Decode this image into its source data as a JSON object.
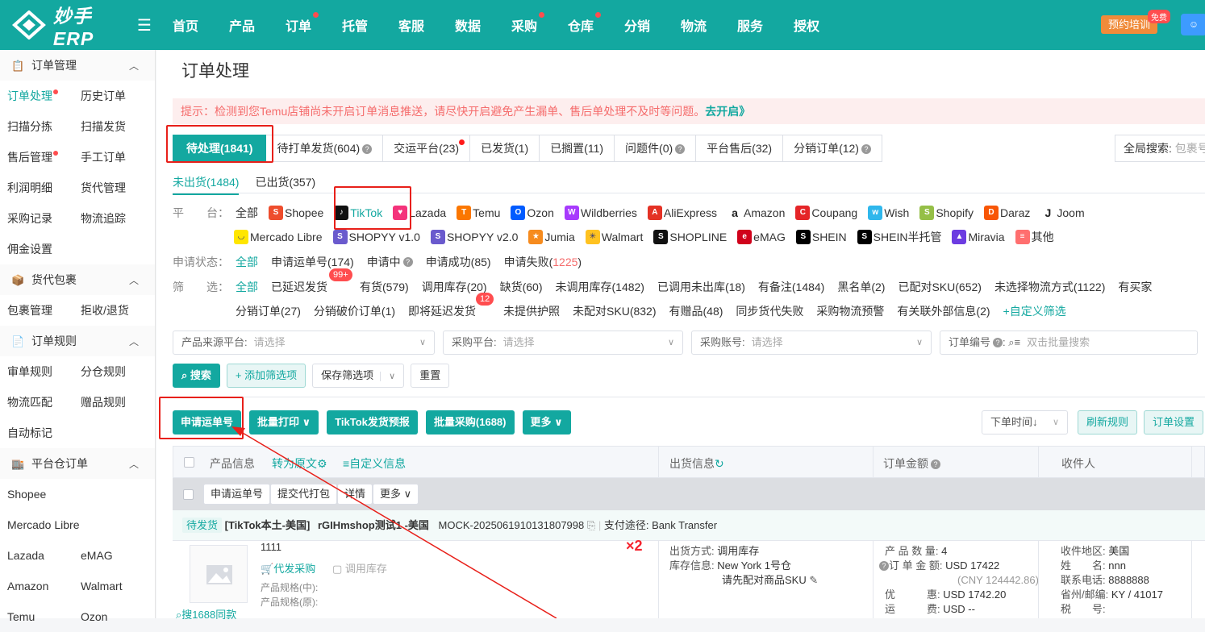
{
  "app": {
    "name": "妙手ERP",
    "train_label": "预约培训",
    "free_badge": "免费"
  },
  "nav": [
    "首页",
    "产品",
    "订单",
    "托管",
    "客服",
    "数据",
    "采购",
    "仓库",
    "分销",
    "物流",
    "服务",
    "授权"
  ],
  "sidebar": {
    "sections": [
      {
        "title": "订单管理",
        "items": [
          "订单处理",
          "历史订单",
          "扫描分拣",
          "扫描发货",
          "售后管理",
          "手工订单",
          "利润明细",
          "货代管理",
          "采购记录",
          "物流追踪",
          "佣金设置"
        ]
      },
      {
        "title": "货代包裹",
        "items": [
          "包裹管理",
          "拒收/退货"
        ]
      },
      {
        "title": "订单规则",
        "items": [
          "审单规则",
          "分仓规则",
          "物流匹配",
          "赠品规则",
          "自动标记"
        ]
      },
      {
        "title": "平台仓订单",
        "items": [
          "Shopee",
          "",
          "Mercado Libre",
          "",
          "Lazada",
          "eMAG",
          "Amazon",
          "Walmart",
          "Temu",
          "Ozon"
        ]
      }
    ]
  },
  "page": {
    "title": "订单处理",
    "notice": "提示：检测到您Temu店铺尚未开启订单消息推送，请尽快开启避免产生漏单、售后单处理不及时等问题。",
    "notice_link": "去开启》",
    "tabs": [
      "待处理(1841)",
      "待打单发货(604)",
      "交运平台(23)",
      "已发货(1)",
      "已搁置(11)",
      "问题件(0)",
      "平台售后(32)",
      "分销订单(12)"
    ],
    "global_search_label": "全局搜索:",
    "global_search_placeholder": "包裹号",
    "subtabs": [
      "未出货(1484)",
      "已出货(357)"
    ],
    "platform_label": "平　　台：",
    "platform_all": "全部",
    "platforms_row1": [
      "Shopee",
      "TikTok",
      "Lazada",
      "Temu",
      "Ozon",
      "Wildberries",
      "AliExpress",
      "Amazon",
      "Coupang",
      "Wish",
      "Shopify",
      "Daraz",
      "Joom"
    ],
    "platforms_row2": [
      "Mercado Libre",
      "SHOPYY v1.0",
      "SHOPYY v2.0",
      "Jumia",
      "Walmart",
      "SHOPLINE",
      "eMAG",
      "SHEIN",
      "SHEIN半托管",
      "Miravia",
      "其他"
    ],
    "apply_label": "申请状态：",
    "apply_status": [
      "全部",
      "申请运单号(174)",
      "申请中",
      "申请成功(85)",
      "申请失败("
    ],
    "apply_fail_count": "1225",
    "filter_label": "筛　　选：",
    "filters_row1": [
      "全部",
      "已延迟发货",
      "有货(579)",
      "调用库存(20)",
      "缺货(60)",
      "未调用库存(1482)",
      "已调用未出库(18)",
      "有备注(1484)",
      "黑名单(2)",
      "已配对SKU(652)",
      "未选择物流方式(1122)",
      "有买家"
    ],
    "delay_badge": "99+",
    "filters_row2": [
      "分销订单(27)",
      "分销破价订单(1)",
      "即将延迟发货",
      "未提供护照",
      "未配对SKU(832)",
      "有赠品(48)",
      "同步货代失败",
      "采购物流预警",
      "有关联外部信息(2)",
      "+自定义筛选"
    ],
    "soon_badge": "12",
    "selects": [
      {
        "label": "产品来源平台:",
        "placeholder": "请选择"
      },
      {
        "label": "采购平台:",
        "placeholder": "请选择"
      },
      {
        "label": "采购账号:",
        "placeholder": "请选择"
      },
      {
        "label": "订单编号",
        "placeholder": "双击批量搜索"
      }
    ],
    "buttons": {
      "search": "搜索",
      "add_filter": "+ 添加筛选项",
      "save_filter": "保存筛选项",
      "reset": "重置"
    },
    "actions": [
      "申请运单号",
      "批量打印",
      "TikTok发货预报",
      "批量采购(1688)",
      "更多"
    ],
    "sort": "下单时间↓",
    "refresh_rule": "刷新规则",
    "order_setting": "订单设置",
    "table_headers": {
      "product": "产品信息",
      "translate": "转为原文",
      "custom": "自定义信息",
      "shipping": "出货信息",
      "amount": "订单金额",
      "receiver": "收件人"
    },
    "bulk": [
      "申请运单号",
      "提交代打包",
      "详情",
      "更多"
    ],
    "order": {
      "status": "待发货",
      "shop": "[TikTok本土-美国]",
      "shop_name": "rGIHmshop测试1 -美国",
      "order_no": "MOCK-20250619101318079​98",
      "pay_label": "支付途径:",
      "pay": "Bank Transfer",
      "product_name": "1111",
      "qty_mark": "×2",
      "agent_buy": "代发采购",
      "use_stock": "调用库存",
      "search_1688": "搜1688同款",
      "spec_cn": "产品规格(中):",
      "spec_raw": "产品规格(原):",
      "ship_way_label": "出货方式:",
      "ship_way": "调用库存",
      "stock_info_label": "库存信息:",
      "stock_info": "New York 1号仓",
      "pair_hint": "请先配对商品SKU",
      "qty_label": "产 品 数 量:",
      "qty": "4",
      "amount_label": "订 单 金 额:",
      "amount": "USD 17422",
      "amount_cny": "(CNY 124442.86)",
      "discount_label": "优　　　惠:",
      "discount": "USD 1742.20",
      "freight_label": "运　　　费:",
      "freight": "USD --",
      "region_label": "收件地区:",
      "region": "美国",
      "name_label": "姓　　名:",
      "name": "nnn",
      "phone_label": "联系电话:",
      "phone": "8888888",
      "zip_label": "省州/邮编:",
      "zip": "KY / 41017",
      "tax_label": "税　　号:"
    }
  }
}
